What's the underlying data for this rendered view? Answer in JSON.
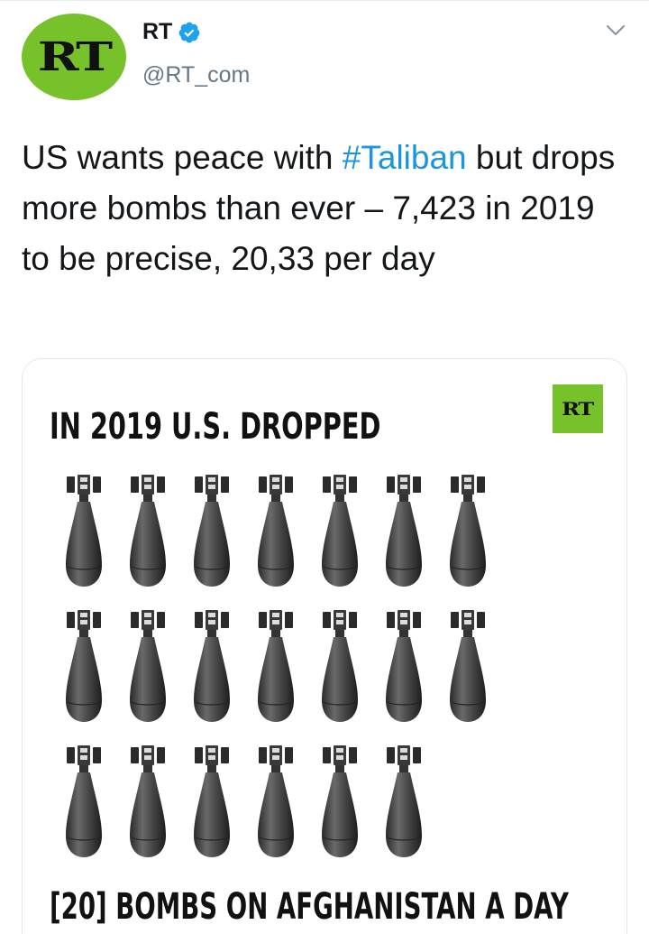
{
  "author": {
    "display_name": "RT",
    "handle": "@RT_com",
    "avatar_text": "RT",
    "verified": true,
    "avatar_color": "#77c12b"
  },
  "tweet": {
    "text_before": "US wants peace with ",
    "hashtag": "#Taliban",
    "text_after": " but drops more bombs than ever – 7,423 in 2019 to be precise, 20,33 per day"
  },
  "menu": {
    "icon": "chevron-down-icon"
  },
  "media": {
    "badge_text": "RT",
    "badge_color": "#77c12b",
    "headline": "IN 2019 U.S. DROPPED",
    "bomb_count": 20,
    "bomb_rows": [
      7,
      7,
      6
    ],
    "footer": "[20] BOMBS ON AFGHANISTAN A DAY"
  },
  "colors": {
    "hashtag": "#1b95e0",
    "verified": "#1da1f2",
    "text": "#14171a",
    "secondary": "#657786"
  }
}
